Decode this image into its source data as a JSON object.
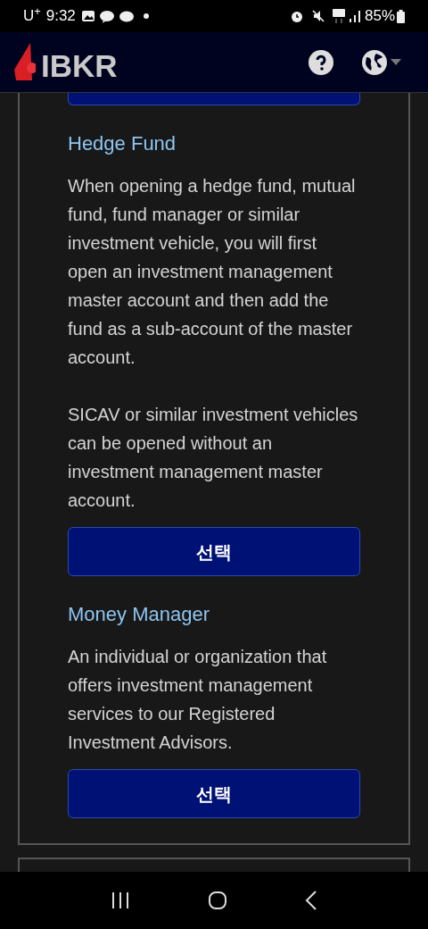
{
  "status_bar": {
    "carrier": "U$^{+}$",
    "time": "9:32",
    "battery": "85%"
  },
  "header": {
    "logo": "IBKR"
  },
  "sections": [
    {
      "title": "Hedge Fund",
      "paragraphs": [
        "When opening a hedge fund, mutual fund, fund manager or similar investment vehicle, you will first open an investment management master account and then add the fund as a sub-account of the master account.",
        "SICAV or similar investment vehicles can be opened without an investment management master account."
      ],
      "button": "선택"
    },
    {
      "title": "Money Manager",
      "paragraphs": [
        "An individual or organization that offers investment management services to our Registered Investment Advisors."
      ],
      "button": "선택"
    }
  ]
}
